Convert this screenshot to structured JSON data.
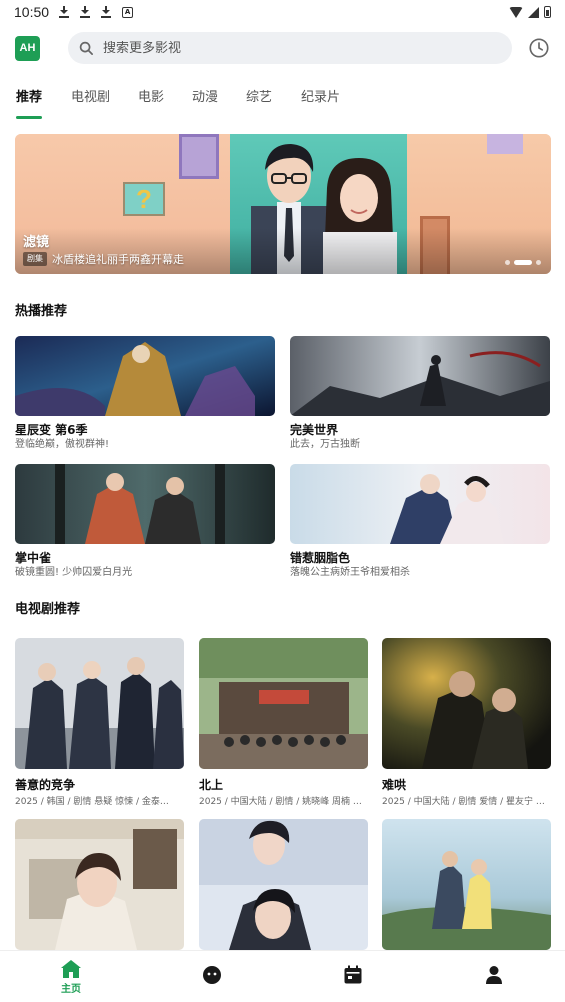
{
  "status_bar": {
    "time": "10:50"
  },
  "header": {
    "logo_text": "AH",
    "search_placeholder": "搜索更多影视"
  },
  "tabs": [
    {
      "label": "推荐",
      "active": true
    },
    {
      "label": "电视剧",
      "active": false
    },
    {
      "label": "电影",
      "active": false
    },
    {
      "label": "动漫",
      "active": false
    },
    {
      "label": "综艺",
      "active": false
    },
    {
      "label": "纪录片",
      "active": false
    }
  ],
  "banner": {
    "title": "滤镜",
    "tag": "剧集",
    "subtitle": "冰盾楼追礼丽手两鑫开幕走",
    "slide_count": 3,
    "active_slide": 1
  },
  "hot_section": {
    "title": "热播推荐",
    "items": [
      {
        "name": "星辰变 第6季",
        "desc": "登临绝巅，傲视群神!"
      },
      {
        "name": "完美世界",
        "desc": "此去，万古独断"
      },
      {
        "name": "掌中雀",
        "desc": "破镜重圆! 少帅囚爱白月光"
      },
      {
        "name": "错惹胭脂色",
        "desc": "落魄公主病娇王爷相爱相杀"
      }
    ]
  },
  "tv_section": {
    "title": "电视剧推荐",
    "items": [
      {
        "name": "善意的竞争",
        "meta": "2025 / 韩国 / 剧情 悬疑 惊悚 / 金泰…"
      },
      {
        "name": "北上",
        "meta": "2025 / 中国大陆 / 剧情 / 姚晓峰 周楠 …"
      },
      {
        "name": "难哄",
        "meta": "2025 / 中国大陆 / 剧情 爱情 / 瞿友宁 …"
      },
      {
        "name": "",
        "meta": ""
      },
      {
        "name": "",
        "meta": ""
      },
      {
        "name": "",
        "meta": ""
      }
    ]
  },
  "bottom_nav": {
    "home_label": "主页"
  },
  "colors": {
    "accent": "#1e9e55",
    "search_bg": "#eef0f3"
  }
}
